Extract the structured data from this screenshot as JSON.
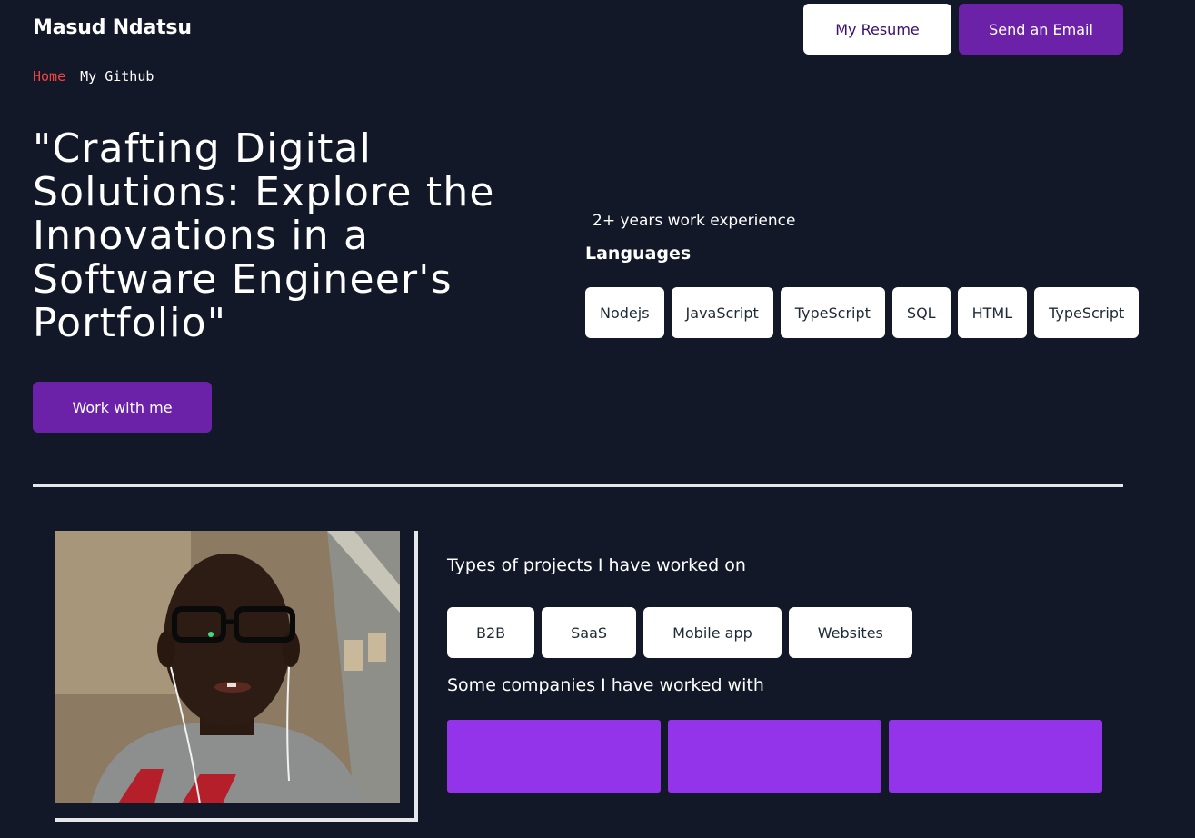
{
  "header": {
    "brand": "Masud Ndatsu",
    "resume_label": "My Resume",
    "email_label": "Send an Email"
  },
  "nav": {
    "home": "Home",
    "github": "My Github"
  },
  "hero": {
    "headline": "\"Crafting Digital Solutions: Explore the Innovations in a Software Engineer's Portfolio\"",
    "cta_label": "Work with me"
  },
  "skills": {
    "experience": "2+ years work experience",
    "languages_title": "Languages",
    "languages": [
      "Nodejs",
      "JavaScript",
      "TypeScript",
      "SQL",
      "HTML",
      "TypeScript"
    ]
  },
  "about": {
    "projects_title": "Types of projects I have worked on",
    "project_types": [
      "B2B",
      "SaaS",
      "Mobile app",
      "Websites"
    ],
    "companies_title": "Some companies I have worked with",
    "company_count": 3
  },
  "colors": {
    "background": "#121828",
    "primary": "#6b21a8",
    "company_card": "#9333ea",
    "nav_active": "#ef4444"
  }
}
